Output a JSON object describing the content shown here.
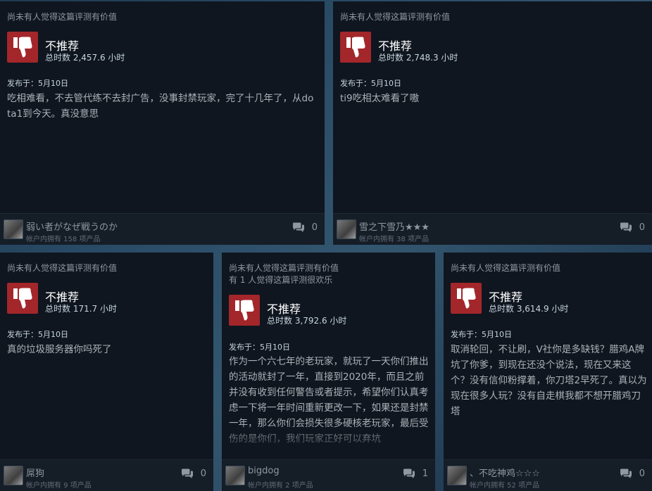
{
  "reviews": [
    {
      "helpful_1": "尚未有人觉得这篇评测有价值",
      "helpful_2": "",
      "verdict": "不推荐",
      "hours": "总时数 2,457.6 小时",
      "posted": "发布于：5月10日",
      "content": "吃相难看，不去管代练不去封广告，没事封禁玩家，完了十几年了，从dota1到今天。真没意思",
      "username": "弱い者がなぜ戦うのか",
      "products": "帐户内拥有 158 项产品",
      "comments": "0"
    },
    {
      "helpful_1": "尚未有人觉得这篇评测有价值",
      "helpful_2": "",
      "verdict": "不推荐",
      "hours": "总时数 2,748.3 小时",
      "posted": "发布于：5月10日",
      "content": "ti9吃相太难看了嗷",
      "username": "雪之下雪乃★★★",
      "products": "帐户内拥有 38 项产品",
      "comments": "0"
    },
    {
      "helpful_1": "尚未有人觉得这篇评测有价值",
      "helpful_2": "",
      "verdict": "不推荐",
      "hours": "总时数 171.7 小时",
      "posted": "发布于：5月10日",
      "content": "真的垃圾服务器你吗死了",
      "username": "屌狗",
      "products": "帐户内拥有 9 项产品",
      "comments": "0"
    },
    {
      "helpful_1": "尚未有人觉得这篇评测有价值",
      "helpful_2": "有 1 人觉得这篇评测很欢乐",
      "verdict": "不推荐",
      "hours": "总时数 3,792.6 小时",
      "posted": "发布于：5月10日",
      "content": "作为一个六七年的老玩家，就玩了一天你们推出的活动就封了一年，直接到2020年，而且之前并没有收到任何警告或者提示，希望你们认真考虑一下将一年时间重新更改一下，如果还是封禁一年，那么你们会损失很多硬核老玩家，最后受伤的是你们，我们玩家正好可以弃坑",
      "username": "bigdog",
      "products": "帐户内拥有 2 项产品",
      "comments": "1"
    },
    {
      "helpful_1": "尚未有人觉得这篇评测有价值",
      "helpful_2": "",
      "verdict": "不推荐",
      "hours": "总时数 3,614.9 小时",
      "posted": "发布于：5月10日",
      "content": "取消轮回，不让刷，V社你是多缺钱？腊鸡A牌坑了你爹，到现在还没个说法，现在又来这个？没有信仰粉撑着，你刀塔2早死了。真以为现在很多人玩？没有自走棋我都不想开腊鸡刀塔",
      "username": "、不吃神鸡☆☆☆",
      "products": "帐户内拥有 52 项产品",
      "comments": "0"
    }
  ],
  "colors": {
    "thumb_bg": "#a3262b",
    "card_bg": "#0f161f",
    "footer_bg": "#151d27"
  },
  "icons": {
    "thumb": "thumbs-down-icon",
    "comment": "comment-icon"
  }
}
